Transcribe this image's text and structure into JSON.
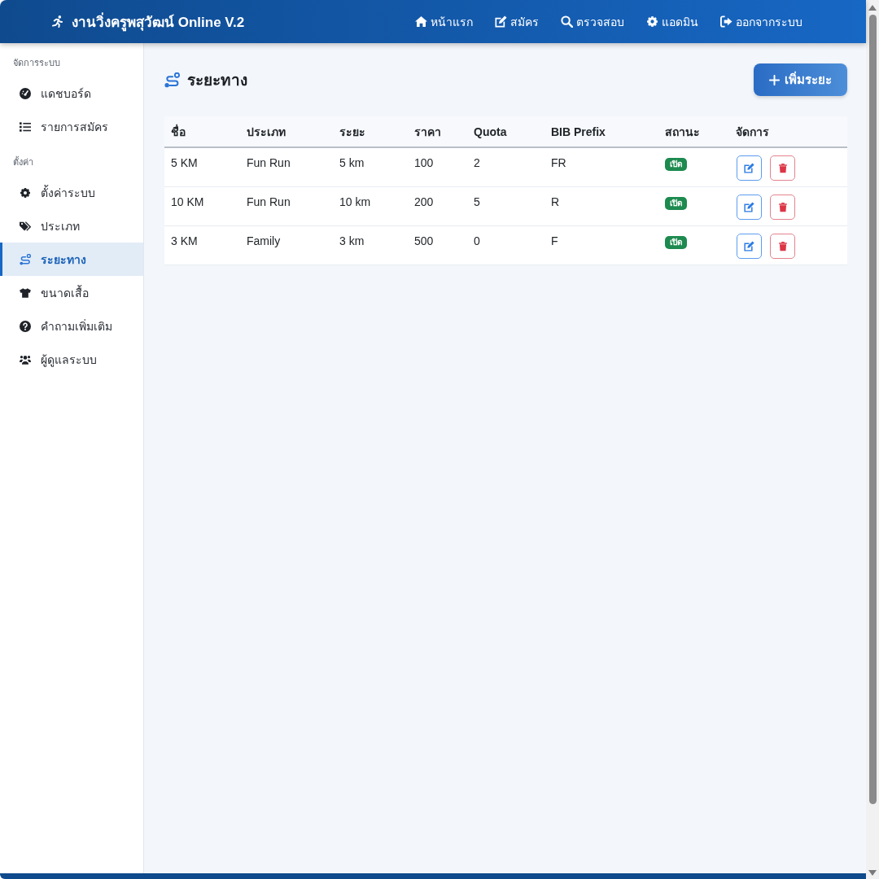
{
  "navbar": {
    "brand": "งานวิ่งครูพสุวัฒน์ Online V.2",
    "links": [
      "หน้าแรก",
      "สมัคร",
      "ตรวจสอบ",
      "แอดมิน",
      "ออกจากระบบ"
    ]
  },
  "sidebar": {
    "sections": [
      {
        "heading": "จัดการระบบ",
        "items": [
          {
            "label": "แดชบอร์ด",
            "selected": false
          },
          {
            "label": "รายการสมัคร",
            "selected": false
          }
        ]
      },
      {
        "heading": "ตั้งค่า",
        "items": [
          {
            "label": "ตั้งค่าระบบ",
            "selected": false
          },
          {
            "label": "ประเภท",
            "selected": false
          },
          {
            "label": "ระยะทาง",
            "selected": true
          },
          {
            "label": "ขนาดเสื้อ",
            "selected": false
          },
          {
            "label": "คำถามเพิ่มเติม",
            "selected": false
          },
          {
            "label": "ผู้ดูแลระบบ",
            "selected": false
          }
        ]
      }
    ]
  },
  "page": {
    "title": "ระยะทาง",
    "add_button": "เพิ่มระยะ"
  },
  "table": {
    "columns": [
      "ชื่อ",
      "ประเภท",
      "ระยะ",
      "ราคา",
      "Quota",
      "BIB Prefix",
      "สถานะ",
      "จัดการ"
    ],
    "rows": [
      {
        "cells": [
          "5 KM",
          "Fun Run",
          "5 km",
          "100",
          "2",
          "FR"
        ],
        "status": "เปิด"
      },
      {
        "cells": [
          "10 KM",
          "Fun Run",
          "10 km",
          "200",
          "5",
          "R"
        ],
        "status": "เปิด"
      },
      {
        "cells": [
          "3 KM",
          "Family",
          "3 km",
          "500",
          "0",
          "F"
        ],
        "status": "เปิด"
      }
    ]
  }
}
